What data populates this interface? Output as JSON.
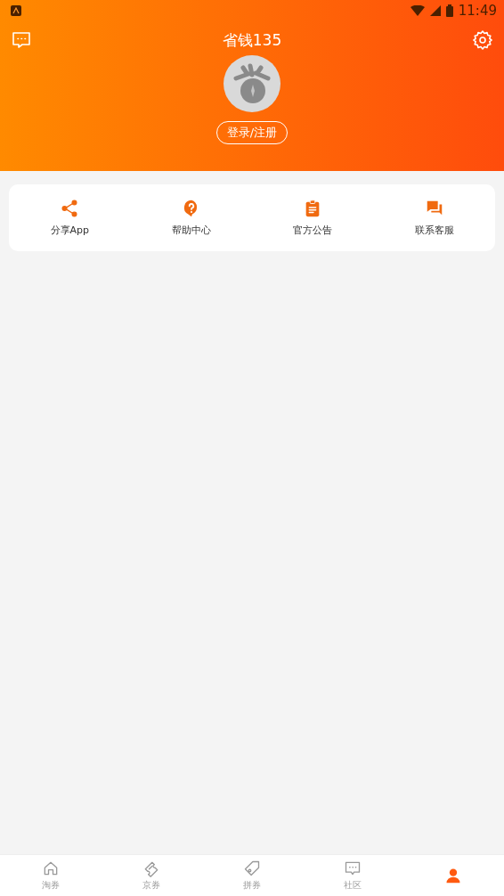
{
  "status_bar": {
    "time": "11:49"
  },
  "header": {
    "title": "省钱135",
    "login_button": "登录/注册"
  },
  "shortcuts": [
    {
      "kind": "share",
      "label": "分享App"
    },
    {
      "kind": "help",
      "label": "帮助中心"
    },
    {
      "kind": "notice",
      "label": "官方公告"
    },
    {
      "kind": "service",
      "label": "联系客服"
    }
  ],
  "bottom_nav": [
    {
      "kind": "home",
      "label": "淘券",
      "selected": false
    },
    {
      "kind": "ticket",
      "label": "京券",
      "selected": false
    },
    {
      "kind": "tag",
      "label": "拼券",
      "selected": false
    },
    {
      "kind": "chat",
      "label": "社区",
      "selected": false
    },
    {
      "kind": "person",
      "selected": true
    }
  ]
}
